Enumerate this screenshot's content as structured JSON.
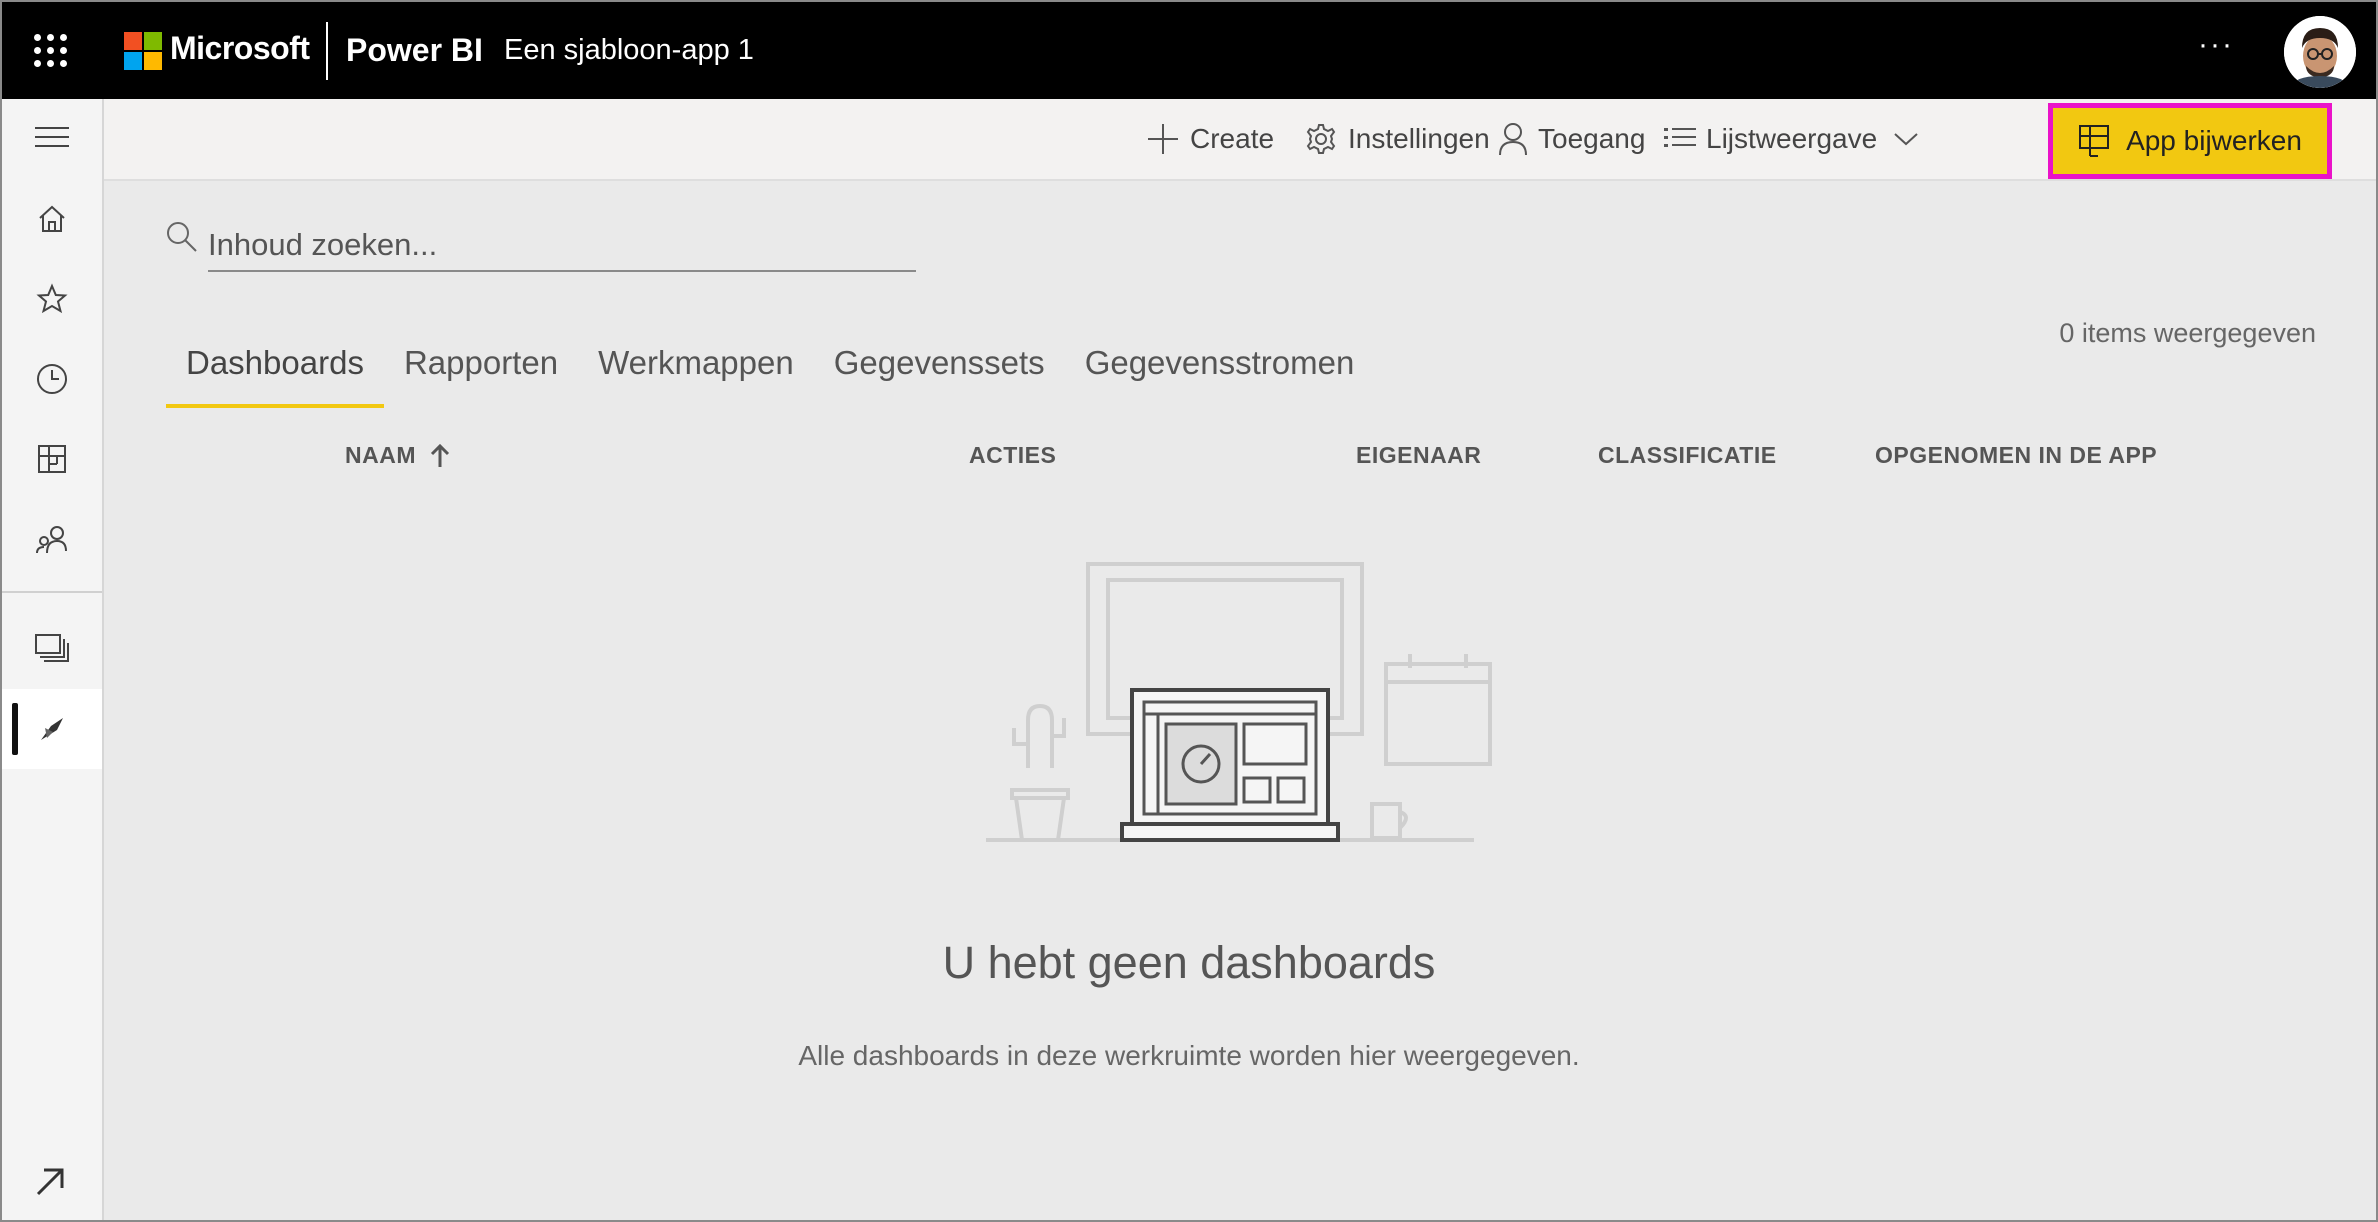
{
  "topbar": {
    "microsoft_label": "Microsoft",
    "product_label": "Power BI",
    "app_title": "Een sjabloon-app 1",
    "more_label": "···"
  },
  "commands": {
    "create": "Create",
    "settings": "Instellingen",
    "access": "Toegang",
    "view": "Lijstweergave",
    "update_app": "App bijwerken",
    "more": "···"
  },
  "search": {
    "placeholder": "Inhoud zoeken..."
  },
  "items_count": "0 items weergegeven",
  "tabs": [
    {
      "label": "Dashboards",
      "active": true
    },
    {
      "label": "Rapporten",
      "active": false
    },
    {
      "label": "Werkmappen",
      "active": false
    },
    {
      "label": "Gegevenssets",
      "active": false
    },
    {
      "label": "Gegevensstromen",
      "active": false
    }
  ],
  "columns": {
    "name": "NAAM",
    "actions": "ACTIES",
    "owner": "EIGENAAR",
    "classification": "CLASSIFICATIE",
    "included": "OPGENOMEN IN DE APP"
  },
  "empty_state": {
    "title": "U hebt geen dashboards",
    "subtitle": "Alle dashboards in deze werkruimte worden hier weergegeven."
  },
  "nav_icons": [
    "hamburger-icon",
    "home-icon",
    "star-icon",
    "clock-icon",
    "apps-icon",
    "shared-icon",
    "workspaces-icon",
    "workspace-app-icon",
    "expand-icon"
  ],
  "colors": {
    "accent": "#f2c811",
    "highlight": "#ea12c8",
    "topbar": "#000000"
  }
}
